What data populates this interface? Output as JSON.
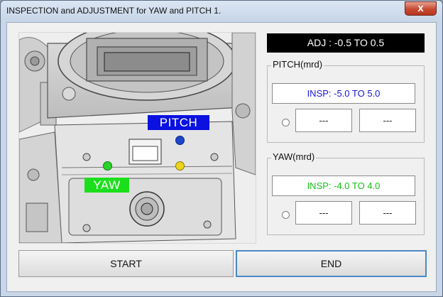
{
  "window": {
    "title": "INSPECTION and ADJUSTMENT for YAW and PITCH 1.",
    "close_label": "x"
  },
  "image": {
    "pitch_label": "PITCH",
    "yaw_label": "YAW",
    "marker_colors": {
      "blue": "#1e46cc",
      "green": "#28d428",
      "yellow": "#ecd41a"
    }
  },
  "adj": {
    "text": "ADJ : -0.5 TO 0.5"
  },
  "pitch": {
    "group_label": "PITCH(mrd)",
    "insp": "INSP: -5.0 TO 5.0",
    "value1": "---",
    "value2": "---"
  },
  "yaw": {
    "group_label": "YAW(mrd)",
    "insp": "INSP: -4.0 TO 4.0",
    "value1": "---",
    "value2": "---"
  },
  "buttons": {
    "start": "START",
    "end": "END"
  }
}
